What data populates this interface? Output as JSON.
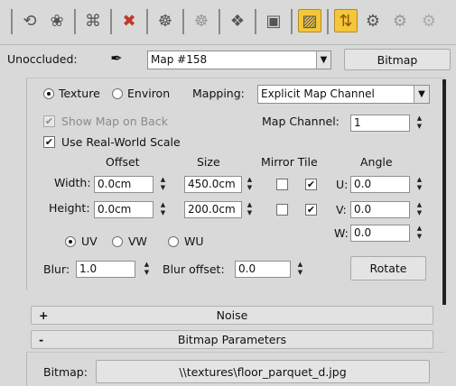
{
  "toolbar": {
    "icons": [
      "pick-from-scene-icon",
      "get-material-icon",
      "put-to-scene-icon",
      "delete-icon",
      "make-unique-icon",
      "put-to-library-icon",
      "material-id-icon",
      "show-in-viewport-icon",
      "show-end-result-icon",
      "go-to-parent-icon",
      "go-forward-icon"
    ]
  },
  "map_row": {
    "label": "Unoccluded:",
    "map_name": "Map #158",
    "type_button": "Bitmap"
  },
  "coordinates": {
    "texture_label": "Texture",
    "environ_label": "Environ",
    "mapping_label": "Mapping:",
    "mapping_value": "Explicit Map Channel",
    "show_map_on_back": "Show Map on Back",
    "map_channel_label": "Map Channel:",
    "map_channel_value": "1",
    "use_real_world_scale": "Use Real-World Scale",
    "headers": {
      "offset": "Offset",
      "size": "Size",
      "mirror_tile": "Mirror Tile",
      "angle": "Angle"
    },
    "width_label": "Width:",
    "width_offset": "0.0cm",
    "width_size": "450.0cm",
    "height_label": "Height:",
    "height_offset": "0.0cm",
    "height_size": "200.0cm",
    "u_label": "U:",
    "u_value": "0.0",
    "v_label": "V:",
    "v_value": "0.0",
    "w_label": "W:",
    "w_value": "0.0",
    "uv_label": "UV",
    "vw_label": "VW",
    "wu_label": "WU",
    "blur_label": "Blur:",
    "blur_value": "1.0",
    "blur_offset_label": "Blur offset:",
    "blur_offset_value": "0.0",
    "rotate_button": "Rotate"
  },
  "rollouts": {
    "noise_sign": "+",
    "noise_title": "Noise",
    "bitmap_sign": "-",
    "bitmap_title": "Bitmap Parameters"
  },
  "bitmap": {
    "label": "Bitmap:",
    "path": "\\\\textures\\floor_parquet_d.jpg"
  },
  "colors": {
    "active_toggle": "#f4c63a",
    "panel_bg": "#d9d9d9"
  }
}
